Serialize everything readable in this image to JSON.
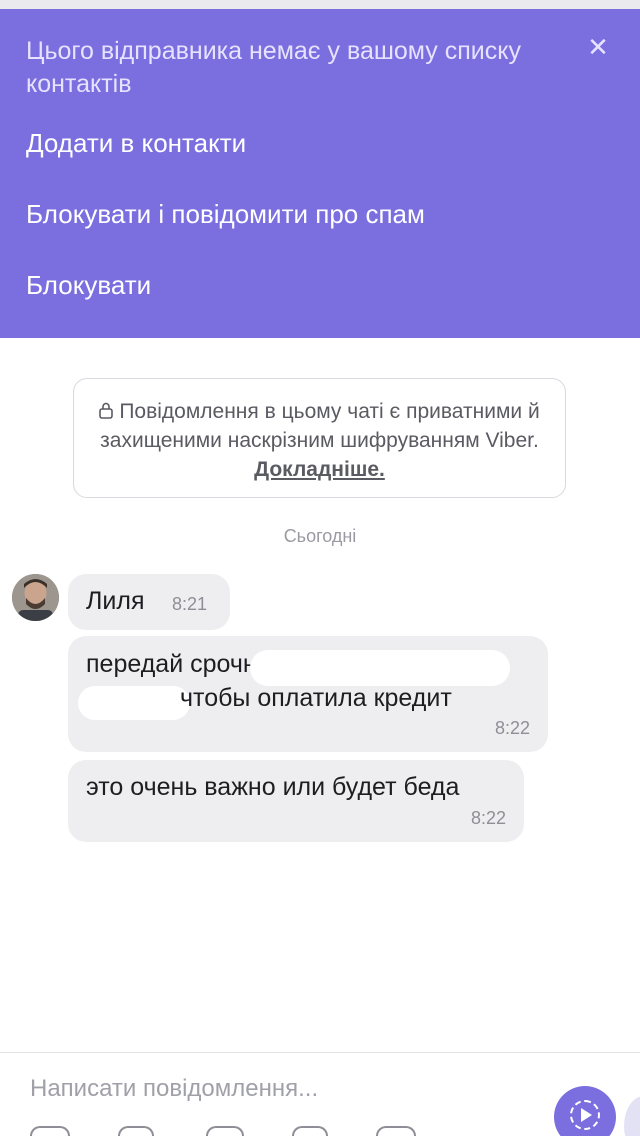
{
  "banner": {
    "title": "Цього відправника немає у вашому списку контактів",
    "close_icon": "close-icon",
    "actions": [
      {
        "label": "Додати в контакти"
      },
      {
        "label": "Блокувати і повідомити про спам"
      },
      {
        "label": "Блокувати"
      }
    ],
    "bg_color": "#7b6fe0"
  },
  "encryption_notice": {
    "text": "Повідомлення в цьому чаті є приватними й захищеними наскрізним шифруванням Viber.",
    "link": "Докладніше.",
    "icon": "lock-icon"
  },
  "date_separator": "Сьогодні",
  "messages": [
    {
      "sender": "Лиля",
      "time": "8:21"
    },
    {
      "line1": "передай срочно",
      "line2": "чтобы оплатила кредит",
      "time": "8:22"
    },
    {
      "text": "это очень важно или будет беда",
      "time": "8:22"
    }
  ],
  "composer": {
    "placeholder": "Написати повідомлення...",
    "send_icon": "send-icon"
  }
}
